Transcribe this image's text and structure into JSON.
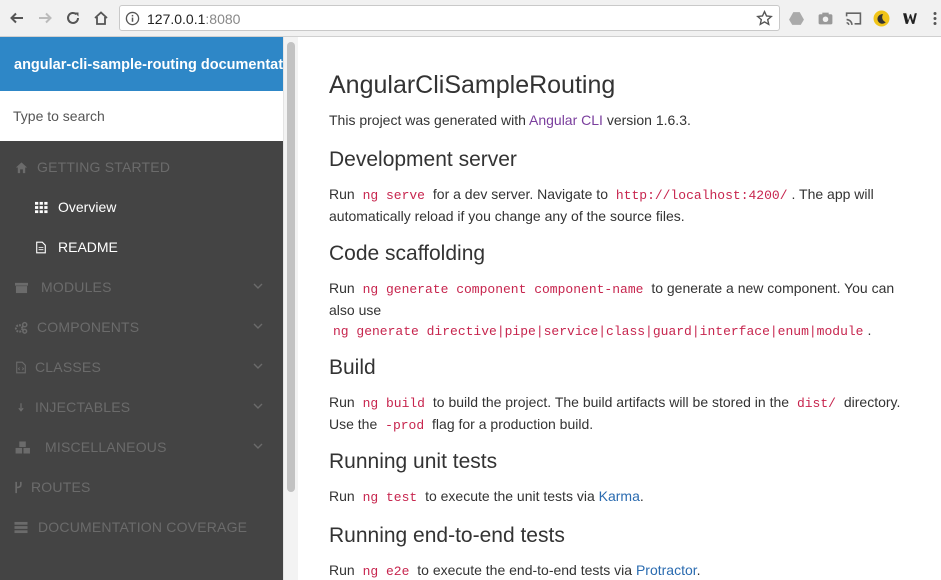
{
  "browser": {
    "url_host": "127.0.0.1",
    "url_port": ":8080"
  },
  "sidebar": {
    "title": "angular-cli-sample-routing documentat...",
    "search_placeholder": "Type to search",
    "items": [
      {
        "label": "GETTING STARTED",
        "icon": "home-icon"
      },
      {
        "label": "Overview",
        "icon": "grid-icon"
      },
      {
        "label": "README",
        "icon": "file-icon"
      },
      {
        "label": "MODULES",
        "icon": "archive-icon"
      },
      {
        "label": "COMPONENTS",
        "icon": "cogs-icon"
      },
      {
        "label": "CLASSES",
        "icon": "file-code-icon"
      },
      {
        "label": "INJECTABLES",
        "icon": "arrow-down-icon"
      },
      {
        "label": "MISCELLANEOUS",
        "icon": "cubes-icon"
      },
      {
        "label": "ROUTES",
        "icon": "code-fork-icon"
      },
      {
        "label": "DOCUMENTATION COVERAGE",
        "icon": "tasks-icon"
      }
    ]
  },
  "content": {
    "title": "AngularCliSampleRouting",
    "intro_before": "This project was generated with ",
    "intro_link": "Angular CLI",
    "intro_after": " version 1.6.3.",
    "dev_server": {
      "heading": "Development server",
      "t1": "Run ",
      "c1": "ng serve",
      "t2": " for a dev server. Navigate to ",
      "c2": "http://localhost:4200/",
      "t3": ". The app will automatically reload if you change any of the source files."
    },
    "scaffolding": {
      "heading": "Code scaffolding",
      "t1": "Run ",
      "c1": "ng generate component component-name",
      "t2": " to generate a new component. You can also use",
      "c2": "ng generate directive|pipe|service|class|guard|interface|enum|module",
      "t3": "."
    },
    "build": {
      "heading": "Build",
      "t1": "Run ",
      "c1": "ng build",
      "t2": " to build the project. The build artifacts will be stored in the ",
      "c2": "dist/",
      "t3": " directory. Use the ",
      "c3": "-prod",
      "t4": " flag for a production build."
    },
    "unit_tests": {
      "heading": "Running unit tests",
      "t1": "Run ",
      "c1": "ng test",
      "t2": " to execute the unit tests via ",
      "link": "Karma",
      "t3": "."
    },
    "e2e_tests": {
      "heading": "Running end-to-end tests",
      "t1": "Run ",
      "c1": "ng e2e",
      "t2": " to execute the end-to-end tests via ",
      "link": "Protractor",
      "t3": "."
    }
  }
}
